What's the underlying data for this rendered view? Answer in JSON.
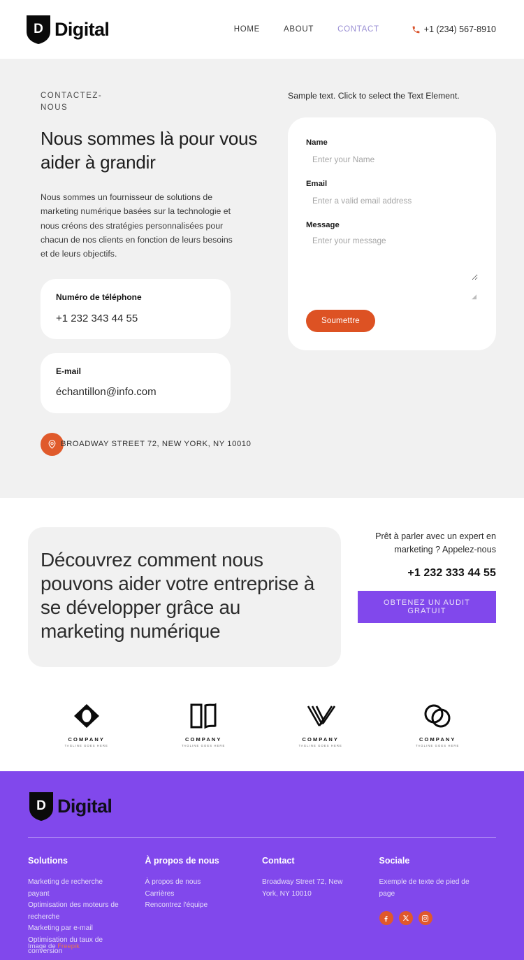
{
  "header": {
    "logo": {
      "letter": "D",
      "name": "Digital"
    },
    "nav": [
      {
        "label": "HOME",
        "active": false
      },
      {
        "label": "ABOUT",
        "active": false
      },
      {
        "label": "CONTACT",
        "active": true
      }
    ],
    "phone": "+1 (234) 567-8910"
  },
  "contact": {
    "eyebrow": "CONTACTEZ-NOUS",
    "title": "Nous sommes là pour vous aider à grandir",
    "description": "Nous sommes un fournisseur de solutions de marketing numérique basées sur la technologie et nous créons des stratégies personnalisées pour chacun de nos clients en fonction de leurs besoins et de leurs objectifs.",
    "cards": [
      {
        "label": "Numéro de téléphone",
        "value": "+1 232 343 44 55"
      },
      {
        "label": "E-mail",
        "value": "échantillon@info.com"
      }
    ],
    "address": "BROADWAY STREET 72, NEW YORK, NY 10010"
  },
  "form": {
    "sample_text": "Sample text. Click to select the Text Element.",
    "fields": [
      {
        "label": "Name",
        "placeholder": "Enter your Name",
        "value": ""
      },
      {
        "label": "Email",
        "placeholder": "Enter a valid email address",
        "value": ""
      },
      {
        "label": "Message",
        "placeholder": "Enter your message",
        "value": ""
      }
    ],
    "submit_label": "Soumettre"
  },
  "cta": {
    "heading": "Découvrez comment nous pouvons aider votre entreprise à se développer grâce au marketing numérique",
    "lead": "Prêt à parler avec un expert en marketing ? Appelez-nous",
    "phone": "+1 232 333 44 55",
    "button_label": "OBTENEZ UN AUDIT GRATUIT"
  },
  "logos": [
    {
      "mark": "lens-mark",
      "name": "COMPANY",
      "tagline": "TAGLINE GOES HERE"
    },
    {
      "mark": "book-mark",
      "name": "COMPANY",
      "tagline": "TAGLINE GOES HERE"
    },
    {
      "mark": "checkv-mark",
      "name": "COMPANY",
      "tagline": "TAGLINE GOES HERE"
    },
    {
      "mark": "rings-mark",
      "name": "COMPANY",
      "tagline": "TAGLINE GOES HERE"
    }
  ],
  "footer": {
    "logo": {
      "letter": "D",
      "name": "Digital"
    },
    "columns": [
      {
        "heading": "Solutions",
        "links": [
          "Marketing de recherche payant",
          "Optimisation des moteurs de recherche",
          "Marketing par e-mail",
          "Optimisation du taux de conversion"
        ]
      },
      {
        "heading": "À propos de nous",
        "links": [
          "À propos de nous",
          "Carrières",
          "Rencontrez l'équipe"
        ]
      },
      {
        "heading": "Contact",
        "text": "Broadway Street 72, New York, NY 10010"
      },
      {
        "heading": "Sociale",
        "text": "Exemple de texte de pied de page",
        "social": [
          "facebook-icon",
          "x-twitter-icon",
          "instagram-icon"
        ]
      }
    ],
    "credit_prefix": "Image de ",
    "credit_link": "Freepik"
  },
  "colors": {
    "accent_orange": "#dd5223",
    "accent_purple": "#8148ec",
    "nav_active": "#9a8fd4",
    "section_gray": "#f1f1f1"
  }
}
